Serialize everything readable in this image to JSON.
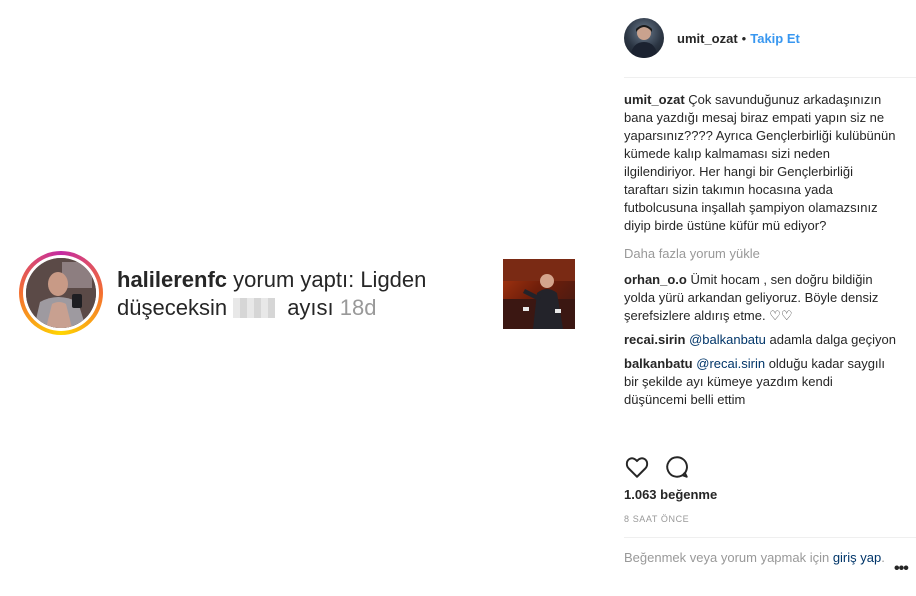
{
  "notification": {
    "username": "halilerenfc",
    "action": " yorum yaptı: Ligden düşeceksin",
    "after_blur": " ayısı",
    "ago": " 18d"
  },
  "header": {
    "username": "umit_ozat",
    "separator": "•",
    "follow_label": "Takip Et"
  },
  "caption": {
    "username": "umit_ozat",
    "text": " Çok savunduğunuz arkadaşınızın bana yazdığı mesaj biraz empati yapın siz ne yaparsınız???? Ayrıca Gençlerbirliği kulübünün kümede kalıp kalmaması sizi neden ilgilendiriyor. Her hangi bir Gençlerbirliği taraftarı sizin takımın hocasına yada futbolcusuna inşallah şampiyon olamazsınız diyip birde üstüne küfür mü ediyor?"
  },
  "load_more": "Daha fazla yorum yükle",
  "comments": [
    {
      "username": "orhan_o.o",
      "text": " Ümit hocam , sen doğru bildiğin yolda yürü arkandan geliyoruz. Böyle densiz şerefsizlere aldırış etme. ",
      "hearts": "♡♡"
    },
    {
      "username": "recai.sirin",
      "mention": "@balkanbatu",
      "text": " adamla dalga geçiyon"
    },
    {
      "username": "balkanbatu",
      "mention": "@recai.sirin",
      "text": " olduğu kadar saygılı bir şekilde ayı kümeye yazdım kendi düşüncemi belli ettim"
    }
  ],
  "likes": "1.063 beğenme",
  "time": "8 SAAT ÖNCE",
  "login_prompt": {
    "text": "Beğenmek veya yorum yapmak için ",
    "link": "giriş yap",
    "end": "."
  },
  "more_options": "•••",
  "colors": {
    "link_blue": "#3897f0",
    "mention_dark_blue": "#003569",
    "muted_gray": "#999999"
  }
}
